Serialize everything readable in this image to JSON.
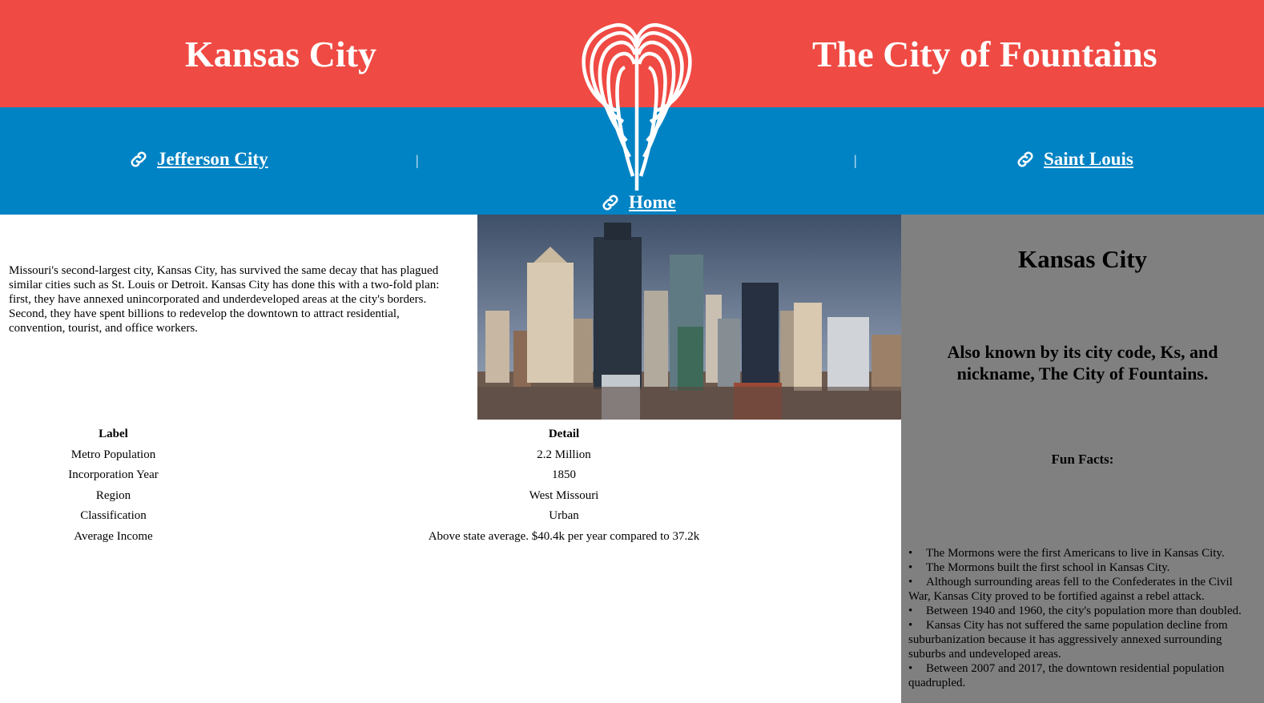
{
  "header": {
    "title_left": "Kansas City",
    "title_right": "The City of Fountains",
    "logo_icon": "fountain-logo-icon",
    "colors": {
      "top": "#ef4a43",
      "nav": "#0083c4"
    }
  },
  "nav": {
    "left_label": "Jefferson City",
    "right_label": "Saint Louis",
    "home_label": "Home",
    "separator": "|",
    "link_icon": "link-icon"
  },
  "intro": "Missouri's second-largest city, Kansas City, has survived the same decay that has plagued similar cities such as St. Louis or Detroit. Kansas City has done this with a two-fold plan: first, they have annexed unincorporated and underdeveloped areas at the city's borders. Second, they have spent billions to redevelop the downtown to attract residential, convention, tourist, and office workers.",
  "table": {
    "headers": [
      "Label",
      "Detail"
    ],
    "rows": [
      [
        "Metro Population",
        "2.2 Million"
      ],
      [
        "Incorporation Year",
        "1850"
      ],
      [
        "Region",
        "West Missouri"
      ],
      [
        "Classification",
        "Urban"
      ],
      [
        "Average Income",
        "Above state average. $40.4k per year compared to 37.2k"
      ]
    ]
  },
  "sidebar": {
    "title": "Kansas City",
    "subtitle": "Also known by its city code, Ks, and nickname, The City of Fountains.",
    "fun_heading": "Fun Facts:",
    "facts": [
      "The Mormons were the first Americans to live in Kansas City.",
      "The Mormons built the first school in Kansas City.",
      "Although surrounding areas fell to the Confederates in the Civil War, Kansas City proved to be fortified against a rebel attack.",
      "Between 1940 and 1960, the city's population more than doubled.",
      "Kansas City has not suffered the same population decline from suburbanization because it has aggressively annexed surrounding suburbs and undeveloped areas.",
      "Between 2007 and 2017, the downtown residential population quadrupled."
    ],
    "bullet": "•",
    "color": "#808080"
  }
}
